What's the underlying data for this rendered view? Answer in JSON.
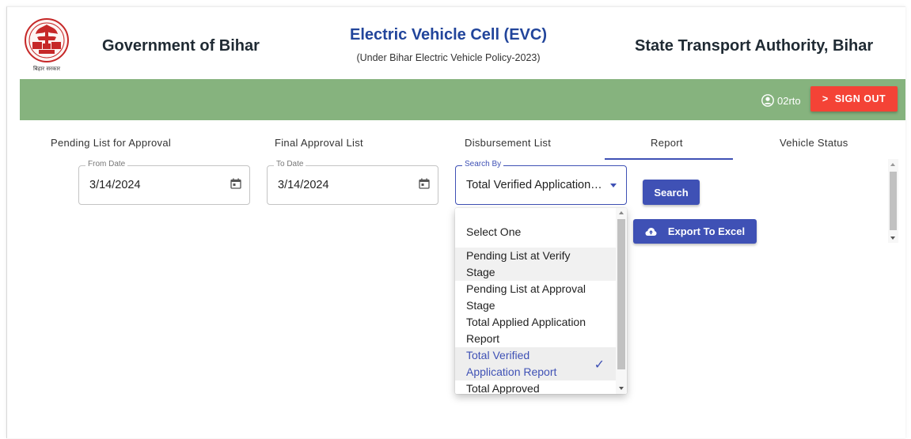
{
  "header": {
    "emblem_caption": "बिहार सरकार",
    "left_title": "Government of Bihar",
    "center_title": "Electric Vehicle Cell (EVC)",
    "center_subtitle": "(Under Bihar Electric Vehicle Policy-2023)",
    "right_title": "State Transport Authority, Bihar"
  },
  "topbar": {
    "user": "02rto",
    "signout_icon": ">",
    "signout_label": "SIGN OUT"
  },
  "tabs": [
    {
      "label": "Pending List for Approval"
    },
    {
      "label": "Final Approval List"
    },
    {
      "label": "Disbursement List"
    },
    {
      "label": "Report",
      "active": true
    },
    {
      "label": "Vehicle Status"
    }
  ],
  "form": {
    "from_date": {
      "label": "From Date",
      "value": "3/14/2024"
    },
    "to_date": {
      "label": "To Date",
      "value": "3/14/2024"
    },
    "search_by": {
      "label": "Search By",
      "value": "Total Verified Application…"
    },
    "search_button": "Search",
    "export_button": "Export To Excel"
  },
  "dropdown": {
    "options": [
      {
        "line1": "Select One"
      },
      {
        "line1": "Pending List at Verify",
        "line2": "Stage"
      },
      {
        "line1": "Pending List at Approval",
        "line2": "Stage"
      },
      {
        "line1": "Total Applied Application",
        "line2": "Report"
      },
      {
        "line1": "Total Verified",
        "line2": "Application Report",
        "selected": true,
        "check": "✓"
      },
      {
        "line1": "Total Approved"
      }
    ]
  },
  "colors": {
    "green_bar": "#86b37e",
    "accent": "#3f51b5",
    "signout": "#f44336",
    "header_blue": "#22459b"
  }
}
